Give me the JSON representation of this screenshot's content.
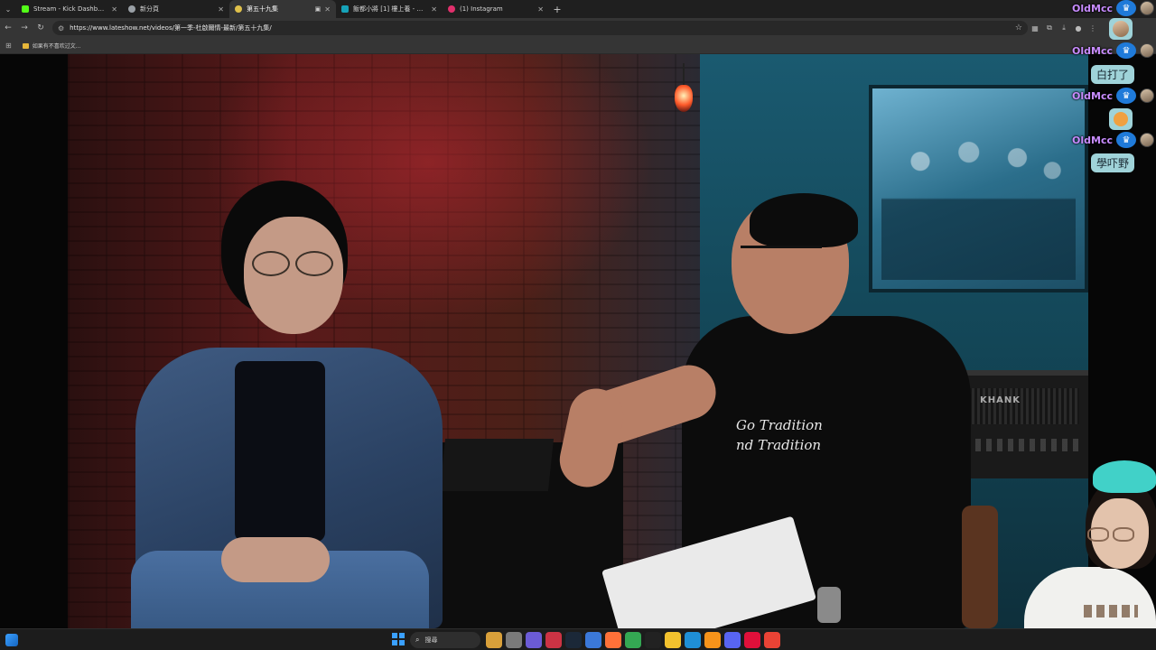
{
  "browser": {
    "tabs": [
      {
        "label": "Stream - Kick Dashboard",
        "favicon_color": "#53fc18",
        "active": false
      },
      {
        "label": "新分頁",
        "favicon_color": "#9aa0a6",
        "active": false
      },
      {
        "label": "第五十九集",
        "favicon_color": "#e0c14b",
        "active": true
      },
      {
        "label": "飯都小將 [1] 樓上養 - 巴哈姆特",
        "favicon_color": "#16a2b8",
        "active": false
      },
      {
        "label": "(1) Instagram",
        "favicon_color": "#e1306c",
        "active": false
      }
    ],
    "new_tab": "+",
    "url": "https://www.lateshow.net/videos/第一季-杜啟爾情-最新/第五十九集/",
    "bookmark": "如果有不喜欢过文..."
  },
  "chat": {
    "username": "OldMcc",
    "messages": [
      {
        "type": "avatar_only"
      },
      {
        "type": "text",
        "text": "白打了"
      },
      {
        "type": "sticker"
      },
      {
        "type": "text",
        "text": "學吓野"
      }
    ]
  },
  "video": {
    "shirt_text_line1": "Go Tradition",
    "shirt_text_line2": "nd Tradition",
    "amp_brand": "KHANK"
  },
  "taskbar": {
    "search_label": "搜尋",
    "apps": [
      {
        "name": "gift-app",
        "color": "#d9a03a"
      },
      {
        "name": "file-explorer",
        "color": "#7a7a7a"
      },
      {
        "name": "chat-app",
        "color": "#6b5bd6"
      },
      {
        "name": "media-app",
        "color": "#cc3344"
      },
      {
        "name": "steam-app",
        "color": "#1b2838"
      },
      {
        "name": "mail-app",
        "color": "#3b78d8"
      },
      {
        "name": "firefox-app",
        "color": "#ff7139"
      },
      {
        "name": "chrome-app",
        "color": "#34a853"
      },
      {
        "name": "capcut-app",
        "color": "#222222"
      },
      {
        "name": "folder-app",
        "color": "#f2c12e"
      },
      {
        "name": "edge-app",
        "color": "#1f8fd6"
      },
      {
        "name": "bitcoin-app",
        "color": "#f7931a"
      },
      {
        "name": "discord-app",
        "color": "#5865f2"
      },
      {
        "name": "opera-app",
        "color": "#e0103a"
      },
      {
        "name": "chrome-profile-app",
        "color": "#ea4335"
      }
    ]
  }
}
